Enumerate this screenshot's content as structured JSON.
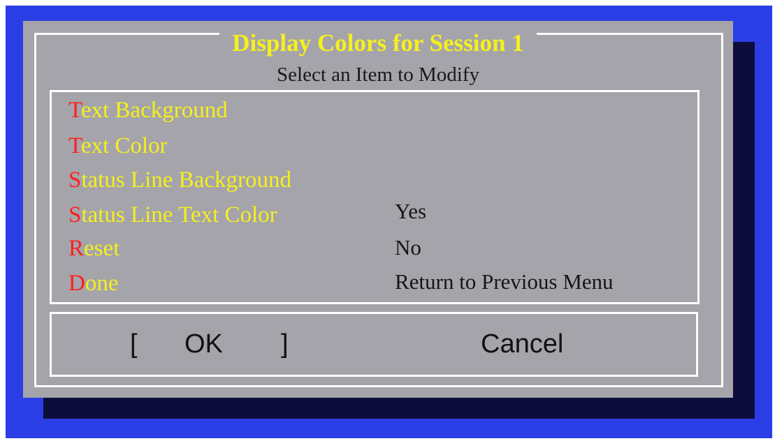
{
  "colors": {
    "screen_background": "#2b3ee6",
    "dialog_background": "#a5a4aa",
    "shadow": "#0c0d3c",
    "frame": "#ffffff",
    "item_text": "#f5f01e",
    "hotkey": "#ff1e1e",
    "option_text": "#161616"
  },
  "dialog": {
    "title": "Display Colors for Session 1",
    "subtitle": "Select an Item to Modify"
  },
  "menu": {
    "items": [
      {
        "hotkey": "T",
        "rest": "ext Background"
      },
      {
        "hotkey": "T",
        "rest": "ext Color"
      },
      {
        "hotkey": "S",
        "rest": "tatus Line Background"
      },
      {
        "hotkey": "S",
        "rest": "tatus Line Text Color"
      },
      {
        "hotkey": "R",
        "rest": "eset"
      },
      {
        "hotkey": "D",
        "rest": "one"
      }
    ]
  },
  "options": {
    "yes": "Yes",
    "no": "No",
    "return": "Return to Previous Menu"
  },
  "buttons": {
    "ok_bracket_left": "[",
    "ok_label": "OK",
    "ok_bracket_right": "]",
    "cancel_label": "Cancel"
  }
}
